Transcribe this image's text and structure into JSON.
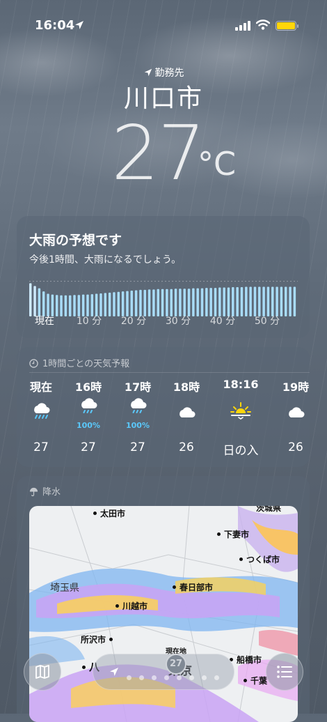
{
  "status_bar": {
    "time": "16:04"
  },
  "header": {
    "location_label": "勤務先",
    "city": "川口市",
    "temperature": "27",
    "unit": "°C"
  },
  "precip_card": {
    "title": "大雨の予想です",
    "subtitle": "今後1時間、大雨になるでしょう。",
    "intensity": [
      0.85,
      0.78,
      0.72,
      0.64,
      0.58,
      0.56,
      0.55,
      0.54,
      0.54,
      0.54,
      0.55,
      0.55,
      0.56,
      0.56,
      0.57,
      0.58,
      0.59,
      0.6,
      0.61,
      0.62,
      0.63,
      0.64,
      0.65,
      0.66,
      0.67,
      0.68,
      0.68,
      0.69,
      0.69,
      0.7,
      0.7,
      0.7,
      0.7,
      0.71,
      0.71,
      0.71,
      0.71,
      0.72,
      0.72,
      0.72,
      0.73,
      0.73,
      0.73,
      0.74,
      0.74,
      0.74,
      0.75,
      0.75,
      0.75,
      0.76,
      0.76,
      0.76,
      0.76,
      0.76,
      0.76,
      0.76,
      0.76,
      0.76,
      0.76,
      0.76,
      0.76
    ],
    "ticks": [
      "現在",
      "10 分",
      "20 分",
      "30 分",
      "40 分",
      "50 分"
    ]
  },
  "hourly": {
    "header": "1時間ごとの天気予報",
    "items": [
      {
        "hour": "現在",
        "icon": "heavy-rain-icon",
        "pct": "",
        "temp": "27"
      },
      {
        "hour": "16時",
        "icon": "rain-icon",
        "pct": "100%",
        "temp": "27"
      },
      {
        "hour": "17時",
        "icon": "rain-icon",
        "pct": "100%",
        "temp": "27"
      },
      {
        "hour": "18時",
        "icon": "cloud-icon",
        "pct": "",
        "temp": "26"
      },
      {
        "hour": "18:16",
        "icon": "sunset-icon",
        "pct": "",
        "temp": "日の入"
      },
      {
        "hour": "19時",
        "icon": "cloud-icon",
        "pct": "",
        "temp": "26"
      }
    ]
  },
  "precip_map": {
    "header": "降水",
    "pin_temp": "27",
    "labels": {
      "ota": "太田市",
      "ibaraki": "茨城県",
      "shimotsuma": "下妻市",
      "tsukuba": "つくば市",
      "saitama": "埼玉県",
      "kasukabe": "春日部市",
      "kawagoe": "川越市",
      "tokorozawa": "所沢市",
      "hachioji": "八",
      "funabashi": "船橋市",
      "tokyo": "東京",
      "chiba": "千葉",
      "genzaichi": "現在地"
    }
  },
  "colors": {
    "accent_blue": "#5ac8fa",
    "battery": "#ffd60a"
  }
}
